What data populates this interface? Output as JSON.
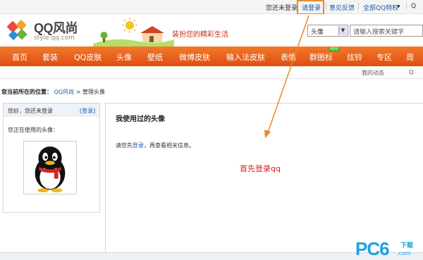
{
  "topbar": {
    "not_logged": "您还未登录",
    "login": "请登录",
    "feedback": "意见反馈",
    "all_features": "全部QQ特权",
    "dropdown_glyph": "▼",
    "cut_char": "Q"
  },
  "header": {
    "logo_name": "QQ风尚",
    "logo_url": "style.qq.com",
    "slogan": "装扮您的精彩生活",
    "search_category": "头像",
    "search_placeholder": "请输入搜索关键字"
  },
  "nav": {
    "items": [
      "首页",
      "套装",
      "QQ皮肤",
      "头像",
      "壁纸",
      "微博皮肤",
      "输入法皮肤",
      "表情",
      "群图标",
      "炫铃",
      "专区",
      "周"
    ],
    "new_badge": "NEW"
  },
  "subnav": {
    "my_activity": "我的动态",
    "cut_char": "Q"
  },
  "breadcrumb": {
    "lead": "您当前所在的位置：",
    "home": "QQ风尚",
    "sep": ">",
    "current": "管理头像"
  },
  "left_panel": {
    "hello": "您好，您还未登录",
    "login_link": "[登录]",
    "using_label": "您正在使用的头像："
  },
  "main_panel": {
    "title": "我使用过的头像",
    "msg_prefix": "请您先",
    "msg_link": "登录",
    "msg_suffix": "，再查看相关信息。"
  },
  "annotation": "首先登录qq",
  "watermark": {
    "pc": "PC",
    "six": "6",
    "download": "下载",
    "com": ".com"
  },
  "colors": {
    "nav_orange": "#e8651c",
    "link_blue": "#1d5aa8",
    "annotation_red": "#d0201c",
    "highlight_orange": "#e8892b"
  }
}
